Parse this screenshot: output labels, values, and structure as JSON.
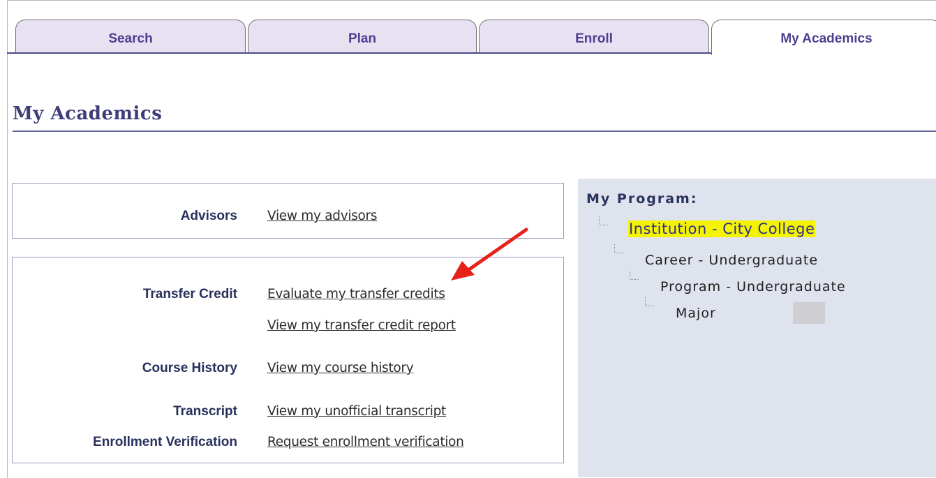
{
  "tabs": [
    {
      "label": "Search",
      "active": false
    },
    {
      "label": "Plan",
      "active": false
    },
    {
      "label": "Enroll",
      "active": false
    },
    {
      "label": "My Academics",
      "active": true
    }
  ],
  "page": {
    "title": "My Academics"
  },
  "advisors": {
    "label": "Advisors",
    "link": "View my advisors"
  },
  "academic_links": {
    "transfer_credit_label": "Transfer Credit",
    "evaluate_transfer_link": "Evaluate my transfer credits",
    "transfer_report_link": "View my transfer credit report",
    "course_history_label": "Course History",
    "course_history_link": "View my course history",
    "transcript_label": "Transcript",
    "transcript_link": "View my unofficial transcript",
    "enrollment_verification_label": "Enrollment Verification",
    "enrollment_verification_link": "Request enrollment verification"
  },
  "program": {
    "title": "My Program:",
    "institution": "Institution - City College",
    "career": "Career - Undergraduate",
    "program": "Program - Undergraduate",
    "major": "Major"
  },
  "colors": {
    "tab_text": "#4e3e8f",
    "tab_bg": "#e8e1f1",
    "title": "#3d3d7a",
    "panel_bg": "#dfe3ed",
    "highlight": "#f4f400",
    "arrow": "#e8211b"
  },
  "icons": {
    "annotation": "red-arrow-icon",
    "tree_connector": "tree-connector-icon"
  }
}
